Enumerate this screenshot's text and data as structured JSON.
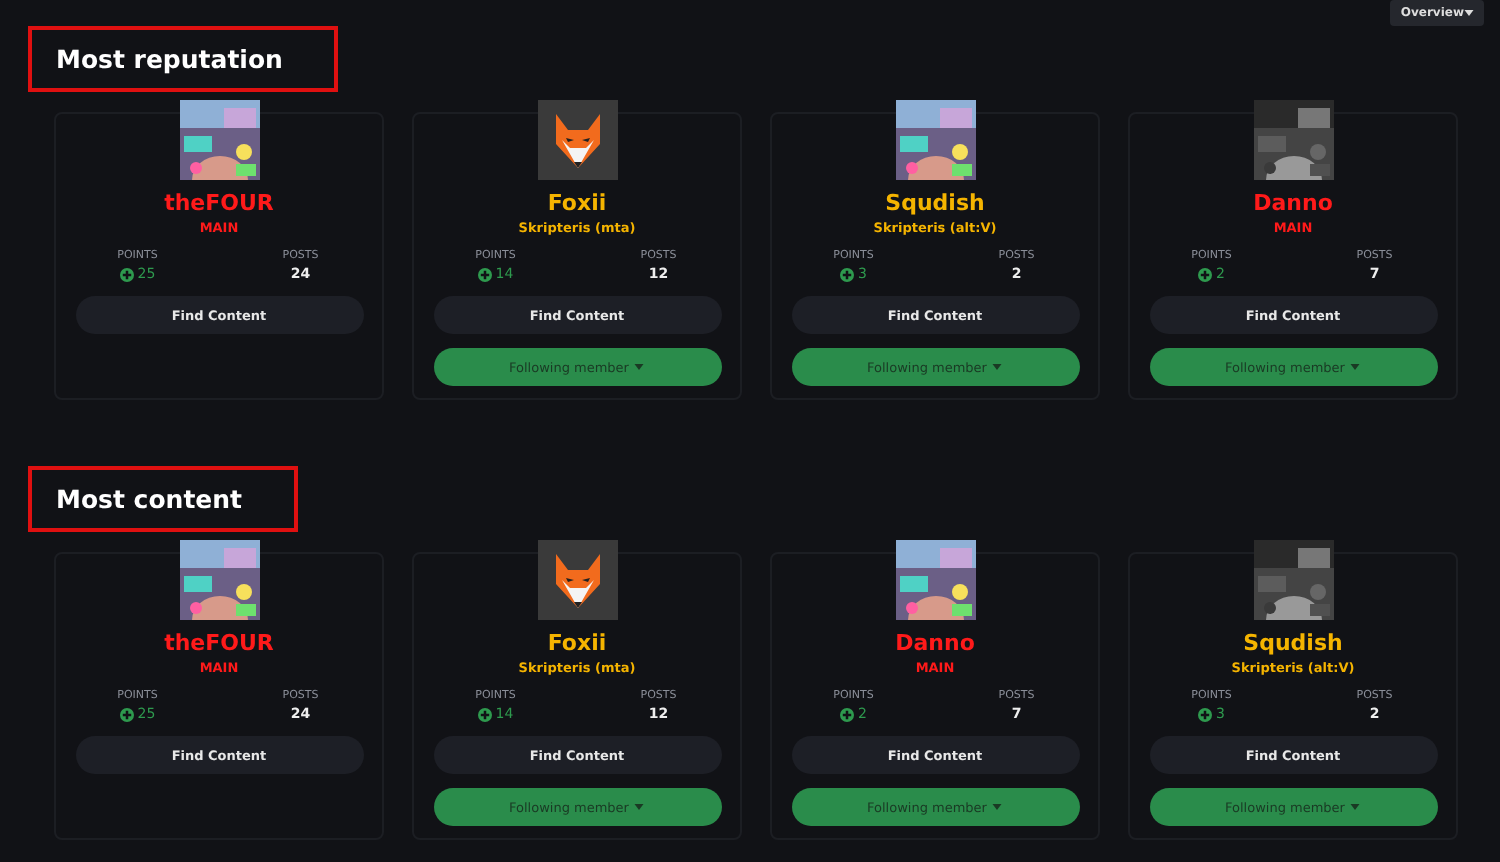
{
  "overview_button": "Overview",
  "sections": [
    {
      "title": "Most reputation",
      "members": [
        {
          "name": "theFOUR",
          "role": "MAIN",
          "color": "#ff1a1a",
          "points_label": "POINTS",
          "points": "25",
          "posts_label": "POSTS",
          "posts": "24",
          "find_button": "Find Content"
        },
        {
          "name": "Foxii",
          "role": "Skripteris (mta)",
          "color": "#f5b400",
          "avatar": {
            "kind": "fox"
          },
          "points_label": "POINTS",
          "points": "14",
          "posts_label": "POSTS",
          "posts": "12",
          "find_button": "Find Content",
          "follow_button": "Following member"
        },
        {
          "name": "Squdish",
          "role": "Skripteris (alt:V)",
          "color": "#f5b400",
          "points_label": "POINTS",
          "points": "3",
          "posts_label": "POSTS",
          "posts": "2",
          "find_button": "Find Content",
          "follow_button": "Following member"
        },
        {
          "name": "Danno",
          "role": "MAIN",
          "color": "#ff1a1a",
          "points_label": "POINTS",
          "points": "2",
          "posts_label": "POSTS",
          "posts": "7",
          "find_button": "Find Content",
          "follow_button": "Following member"
        }
      ]
    },
    {
      "title": "Most content",
      "members": [
        {
          "name": "theFOUR",
          "role": "MAIN",
          "color": "#ff1a1a",
          "points_label": "POINTS",
          "points": "25",
          "posts_label": "POSTS",
          "posts": "24",
          "find_button": "Find Content"
        },
        {
          "name": "Foxii",
          "role": "Skripteris (mta)",
          "color": "#f5b400",
          "avatar": {
            "kind": "fox"
          },
          "points_label": "POINTS",
          "points": "14",
          "posts_label": "POSTS",
          "posts": "12",
          "find_button": "Find Content",
          "follow_button": "Following member"
        },
        {
          "name": "Danno",
          "role": "MAIN",
          "color": "#ff1a1a",
          "points_label": "POINTS",
          "points": "2",
          "posts_label": "POSTS",
          "posts": "7",
          "find_button": "Find Content",
          "follow_button": "Following member"
        },
        {
          "name": "Squdish",
          "role": "Skripteris (alt:V)",
          "color": "#f5b400",
          "points_label": "POINTS",
          "points": "3",
          "posts_label": "POSTS",
          "posts": "2",
          "find_button": "Find Content",
          "follow_button": "Following member"
        }
      ]
    }
  ]
}
